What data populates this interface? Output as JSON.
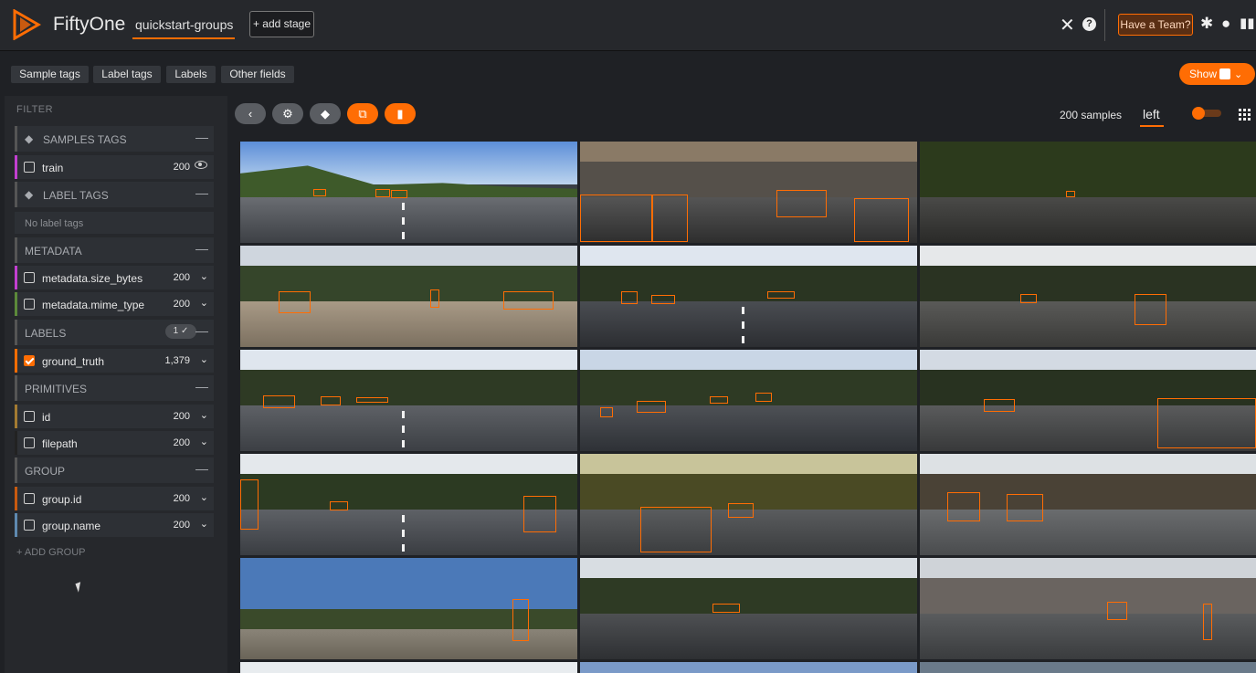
{
  "header": {
    "brand": "FiftyOne",
    "dataset": "quickstart-groups",
    "add_stage": "+ add stage",
    "team_button": "Have a Team?",
    "icons": [
      "close-icon",
      "help-icon",
      "slack-icon",
      "github-icon",
      "docs-icon"
    ]
  },
  "subtabs": [
    "Sample tags",
    "Label tags",
    "Labels",
    "Other fields"
  ],
  "show_button": "Show",
  "sidebar": {
    "filter_title": "FILTER",
    "samples_tags": "SAMPLES TAGS",
    "train": {
      "label": "train",
      "count": "200"
    },
    "label_tags": "LABEL TAGS",
    "no_label_tags": "No label tags",
    "metadata": "METADATA",
    "size_bytes": {
      "label": "metadata.size_bytes",
      "count": "200"
    },
    "mime_type": {
      "label": "metadata.mime_type",
      "count": "200"
    },
    "labels": "LABELS",
    "labels_badge": "1 ✓",
    "ground_truth": {
      "label": "ground_truth",
      "count": "1,379"
    },
    "primitives": "PRIMITIVES",
    "id": {
      "label": "id",
      "count": "200"
    },
    "filepath": {
      "label": "filepath",
      "count": "200"
    },
    "group": "GROUP",
    "group_id": {
      "label": "group.id",
      "count": "200"
    },
    "group_name": {
      "label": "group.name",
      "count": "200"
    },
    "add_group": "+ ADD GROUP"
  },
  "toolbar": {
    "sample_count": "200 samples",
    "slice": "left"
  },
  "colors": {
    "accent": "#ff6d04",
    "samples_tags": "#c33fd0",
    "metadata": "#c33fd0",
    "mime": "#5c8a3a",
    "labels": "#ff6d04",
    "id": "#a37b32",
    "filepath": "#cfcfcf",
    "group_id": "#ff6d04",
    "group_name": "#5f8ab0"
  }
}
